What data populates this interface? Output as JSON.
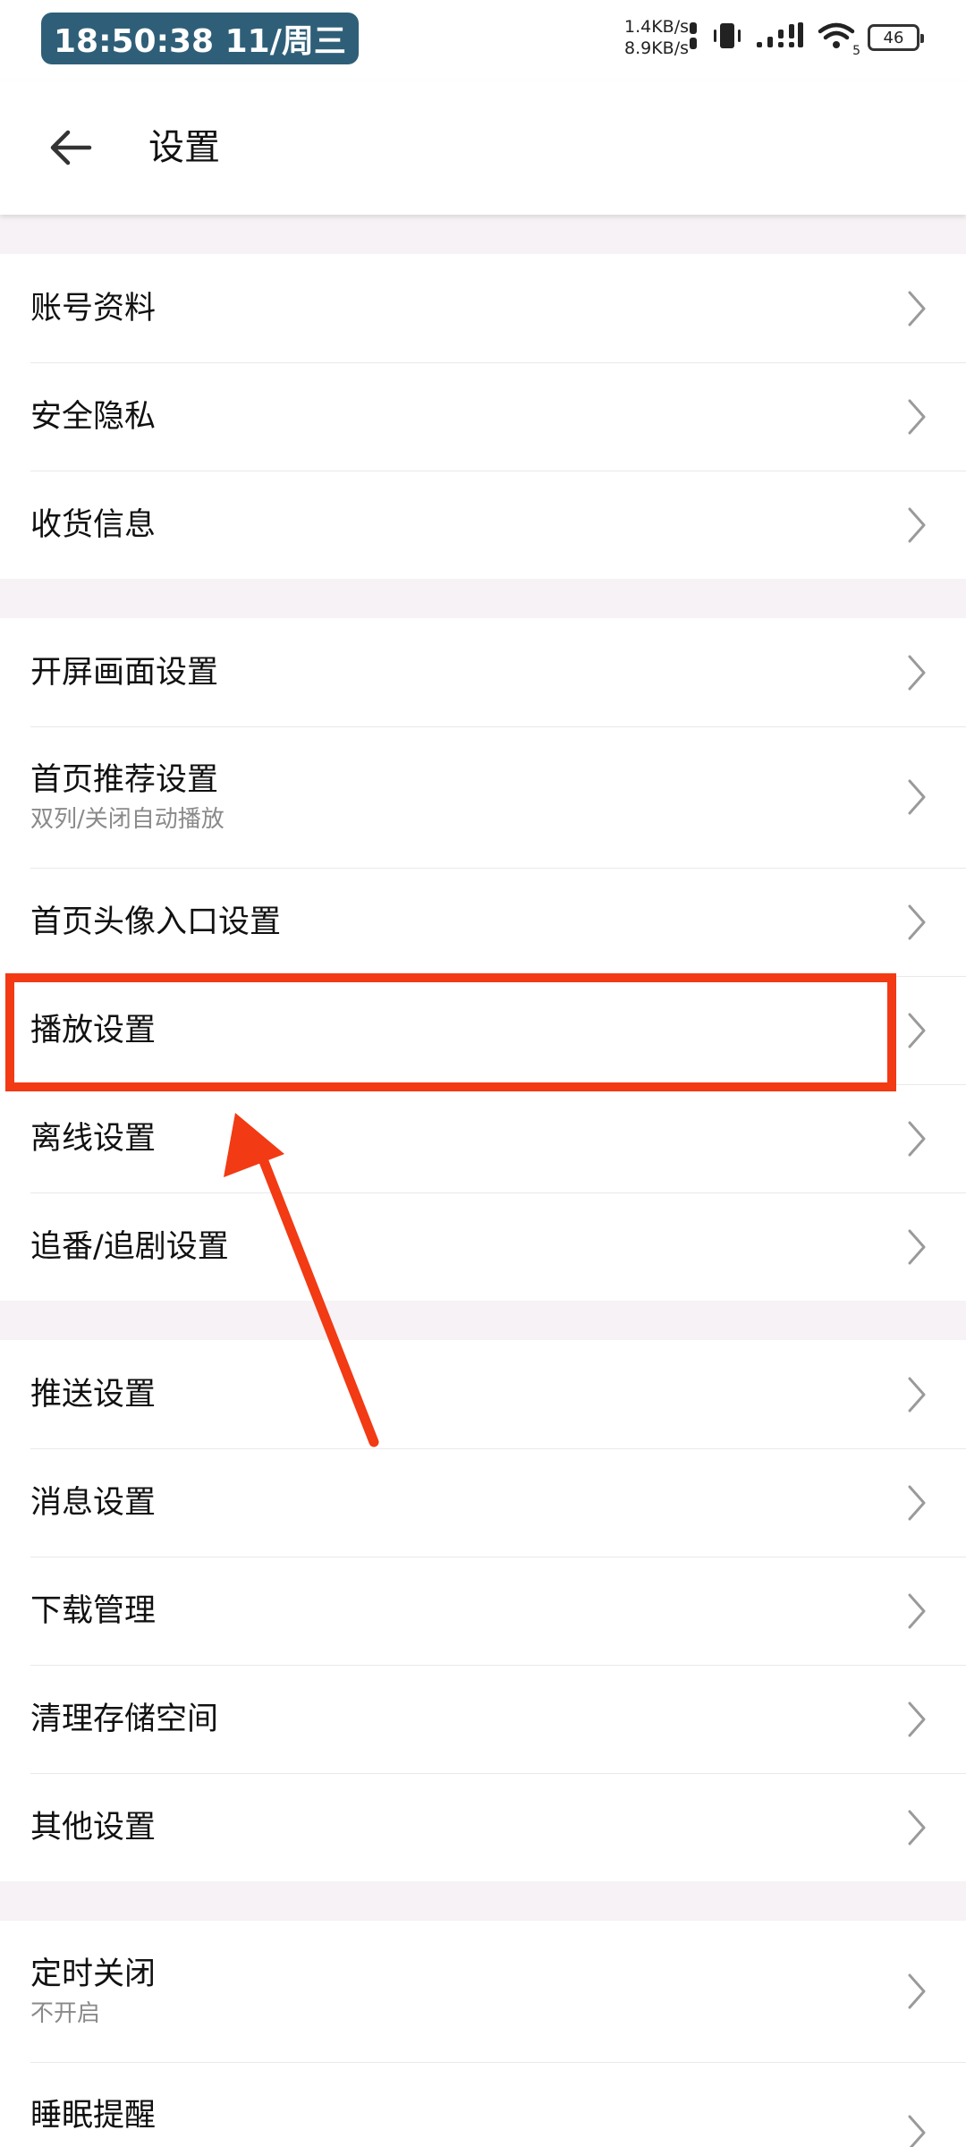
{
  "status_bar": {
    "time": "18:50:38 11/周三",
    "net_up": "1.4KB/s",
    "net_down": "8.9KB/s",
    "wifi_label": "5",
    "battery": "46"
  },
  "header": {
    "title": "设置"
  },
  "groups": [
    {
      "items": [
        {
          "label": "账号资料"
        },
        {
          "label": "安全隐私"
        },
        {
          "label": "收货信息"
        }
      ]
    },
    {
      "items": [
        {
          "label": "开屏画面设置"
        },
        {
          "label": "首页推荐设置",
          "sub": "双列/关闭自动播放"
        },
        {
          "label": "首页头像入口设置"
        },
        {
          "label": "播放设置"
        },
        {
          "label": "离线设置"
        },
        {
          "label": "追番/追剧设置"
        }
      ]
    },
    {
      "items": [
        {
          "label": "推送设置"
        },
        {
          "label": "消息设置"
        },
        {
          "label": "下载管理"
        },
        {
          "label": "清理存储空间"
        },
        {
          "label": "其他设置"
        }
      ]
    },
    {
      "items": [
        {
          "label": "定时关闭",
          "sub": "不开启"
        },
        {
          "label": "睡眠提醒"
        }
      ]
    }
  ],
  "colors": {
    "accent_annotation": "#f23a14",
    "clock_bg": "#2f5f78",
    "section_gap": "#f6f2f5"
  },
  "icons": [
    "back-arrow-icon",
    "chevron-right-icon",
    "signal-icon",
    "wifi-icon",
    "vibrate-icon",
    "battery-icon"
  ]
}
